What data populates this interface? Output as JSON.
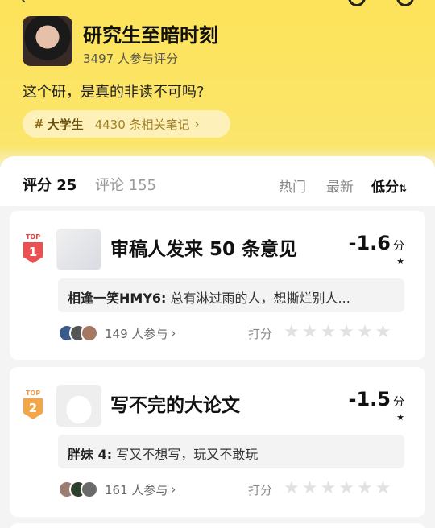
{
  "topic": {
    "title": "研究生至暗时刻",
    "participants": "3497 人参与评分",
    "question": "这个研，是真的非读不可吗?",
    "tag": {
      "hash": "#",
      "name": "大学生",
      "count": "4430 条相关笔记",
      "chevron": "›"
    }
  },
  "tabs": {
    "score": "评分 25",
    "comments": "评论 155"
  },
  "sort": {
    "hot": "热门",
    "new": "最新",
    "low": "低分",
    "low_icon": "⇅"
  },
  "items": [
    {
      "rank_label": "TOP",
      "rank": "1",
      "title": "审稿人发来 50 条意见",
      "score": "-1.6",
      "score_unit": "分",
      "comment_user": "相逢一笑HMY6:",
      "comment_text": "总有淋过雨的人，想撕烂别人...",
      "participants": "149 人参与",
      "chevron": "›",
      "rate_label": "打分"
    },
    {
      "rank_label": "TOP",
      "rank": "2",
      "title": "写不完的大论文",
      "score": "-1.5",
      "score_unit": "分",
      "comment_user": "胖妹 4:",
      "comment_text": "写又不想写，玩又不敢玩",
      "participants": "161 人参与",
      "chevron": "›",
      "rate_label": "打分"
    }
  ],
  "colors": {
    "header_yellow": "#fde35a",
    "rank1": "#ec5050",
    "rank2": "#f4a548"
  }
}
